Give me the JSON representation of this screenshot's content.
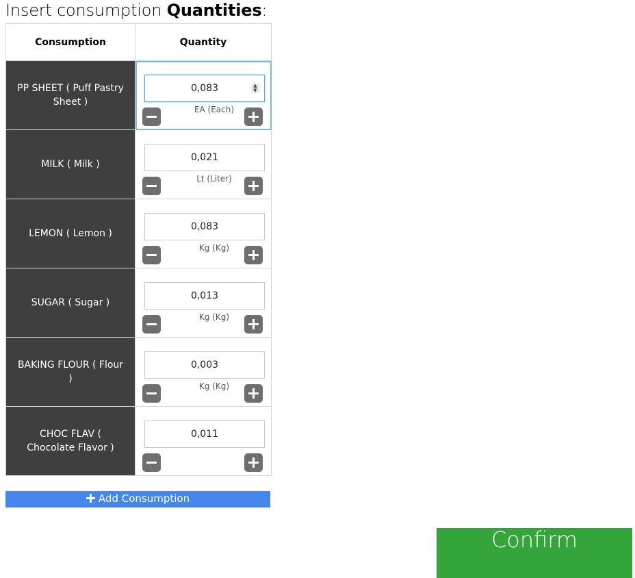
{
  "title": {
    "prefix": "Insert consumption ",
    "emphasis": "Quantities",
    "suffix": ":"
  },
  "table": {
    "headers": [
      "Consumption",
      "Quantity"
    ],
    "rows": [
      {
        "name": "PP SHEET ( Puff Pastry Sheet )",
        "quantity": "0,083",
        "unit": "EA (Each)",
        "active": true
      },
      {
        "name": "MILK ( Milk )",
        "quantity": "0,021",
        "unit": "Lt (Liter)",
        "active": false
      },
      {
        "name": "LEMON ( Lemon )",
        "quantity": "0,083",
        "unit": "Kg (Kg)",
        "active": false
      },
      {
        "name": "SUGAR ( Sugar )",
        "quantity": "0,013",
        "unit": "Kg (Kg)",
        "active": false
      },
      {
        "name": "BAKING FLOUR ( Flour )",
        "quantity": "0,003",
        "unit": "Kg (Kg)",
        "active": false
      },
      {
        "name": "CHOC FLAV ( Chocolate Flavor )",
        "quantity": "0,011",
        "unit": "",
        "active": false
      }
    ]
  },
  "add_button": {
    "label": "Add Consumption",
    "icon": "plus-icon"
  },
  "confirm_button": {
    "label": "Confirm"
  },
  "colors": {
    "name_cell_bg": "#3f3f3f",
    "add_button_bg": "#4486ec",
    "confirm_bg": "#33a53b",
    "stepper_bg": "#6e6e6e",
    "active_outline": "#7bb8de"
  }
}
